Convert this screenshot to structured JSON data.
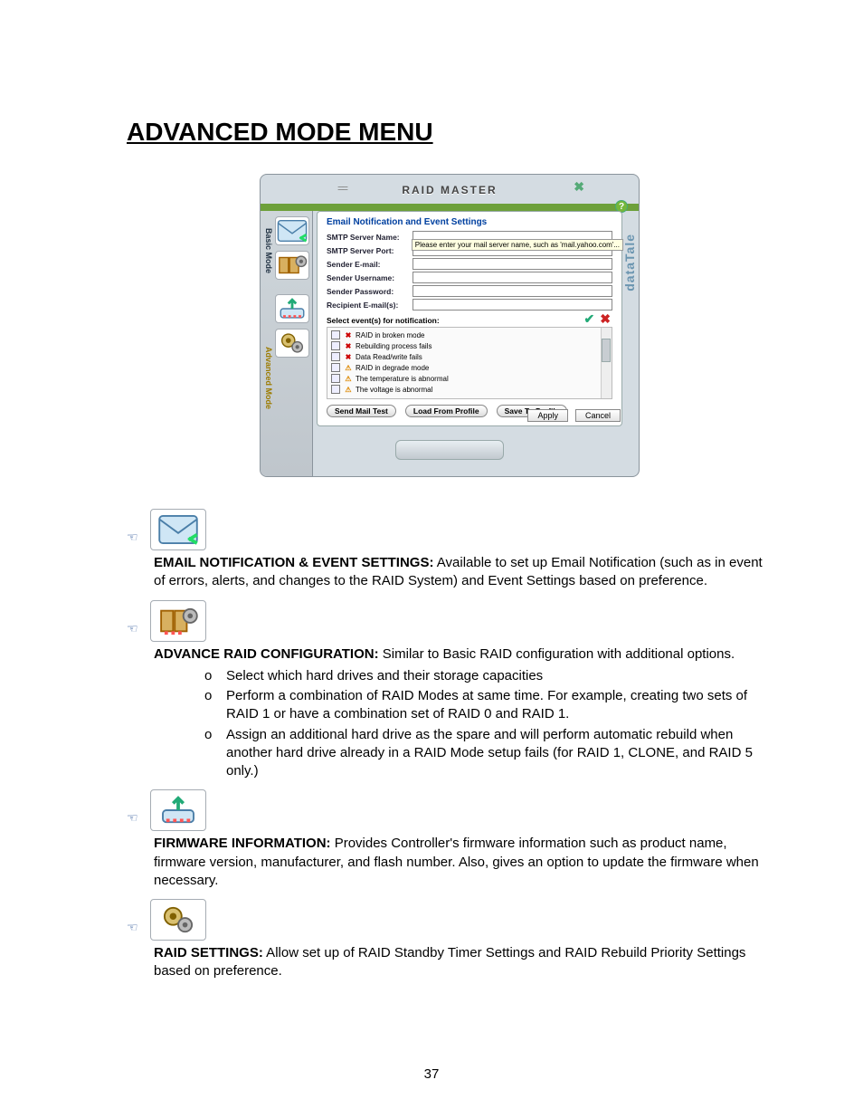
{
  "doc": {
    "title": "ADVANCED MODE MENU",
    "page_number": "37"
  },
  "shot": {
    "app_title": "RAID MASTER",
    "drag_handle": "==",
    "close_glyph": "✖",
    "help_glyph": "?",
    "brand_right": "dataTale",
    "side": {
      "basic_label": "Basic Mode",
      "advanced_label": "Advanced Mode"
    },
    "panel": {
      "title": "Email Notification and Event Settings",
      "tooltip": "Please enter your mail server name, such as 'mail.yahoo.com'...",
      "fields": {
        "server_name": "SMTP Server Name:",
        "server_port": "SMTP Server Port:",
        "sender_email": "Sender E-mail:",
        "sender_user": "Sender Username:",
        "sender_pass": "Sender Password:",
        "recipient": "Recipient E-mail(s):"
      },
      "section_label": "Select event(s) for notification:",
      "events": [
        {
          "icon": "✖",
          "cls": "evt-red",
          "label": "RAID in broken mode"
        },
        {
          "icon": "✖",
          "cls": "evt-red",
          "label": "Rebuilding process fails"
        },
        {
          "icon": "✖",
          "cls": "evt-red",
          "label": "Data Read/write fails"
        },
        {
          "icon": "⚠",
          "cls": "evt-yel",
          "label": "RAID in degrade mode"
        },
        {
          "icon": "⚠",
          "cls": "evt-yel",
          "label": "The temperature is abnormal"
        },
        {
          "icon": "⚠",
          "cls": "evt-yel",
          "label": "The voltage is abnormal"
        }
      ],
      "check_glyph": "✔",
      "x_glyph": "✖",
      "buttons": {
        "send_test": "Send Mail Test",
        "load": "Load From Profile",
        "save": "Save To Profile",
        "apply": "Apply",
        "cancel": "Cancel"
      }
    }
  },
  "sections": {
    "email": {
      "head": "EMAIL NOTIFICATION & EVENT SETTINGS:",
      "body": " Available to set up Email Notification (such as in event of errors, alerts, and changes to the RAID System) and Event Settings based on preference."
    },
    "adv_raid": {
      "head": "ADVANCE RAID CONFIGURATION:",
      "body": "  Similar to Basic RAID configuration with additional options.",
      "bullets": [
        "Select which hard drives and their storage capacities",
        "Perform a combination of RAID Modes at same time. For example, creating two sets of RAID 1 or have a combination set of RAID 0 and RAID 1.",
        "Assign an additional hard drive as the spare and will perform automatic rebuild when another hard drive already in a RAID Mode setup fails (for RAID 1, CLONE, and RAID 5 only.)"
      ]
    },
    "fw": {
      "head": "FIRMWARE INFORMATION:",
      "body": "  Provides Controller's firmware information such as product name, firmware version, manufacturer, and flash number.  Also, gives an option to update the firmware when necessary."
    },
    "raid_set": {
      "head": "RAID SETTINGS:",
      "body": " Allow set up of RAID Standby Timer Settings and RAID Rebuild Priority Settings based on preference."
    }
  }
}
